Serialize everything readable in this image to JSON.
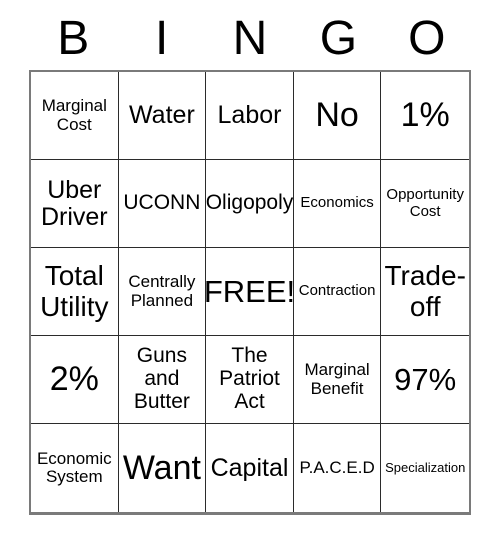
{
  "card": {
    "header_letters": [
      "B",
      "I",
      "N",
      "G",
      "O"
    ],
    "free_space_label": "FREE!",
    "colors": {
      "background": "#ffffff",
      "text": "#000000",
      "cell_border": "#2b2b2b",
      "outer_border": "#7a7a7a"
    },
    "grid": {
      "columns": 5,
      "rows": 5,
      "cells": [
        {
          "text": "Marginal\nCost",
          "size": "sm"
        },
        {
          "text": "Water",
          "size": "ml"
        },
        {
          "text": "Labor",
          "size": "ml"
        },
        {
          "text": "No",
          "size": "xxl"
        },
        {
          "text": "1%",
          "size": "xxl"
        },
        {
          "text": "Uber\nDriver",
          "size": "ml"
        },
        {
          "text": "UCONN",
          "size": "md"
        },
        {
          "text": "Oligopoly",
          "size": "md"
        },
        {
          "text": "Economics",
          "size": "xs"
        },
        {
          "text": "Opportunity\nCost",
          "size": "xs"
        },
        {
          "text": "Total\nUtility",
          "size": "lg"
        },
        {
          "text": "Centrally\nPlanned",
          "size": "sm"
        },
        {
          "text": "FREE!",
          "size": "xl"
        },
        {
          "text": "Contraction",
          "size": "xs"
        },
        {
          "text": "Trade-\noff",
          "size": "lg"
        },
        {
          "text": "2%",
          "size": "xxl"
        },
        {
          "text": "Guns\nand\nButter",
          "size": "md"
        },
        {
          "text": "The\nPatriot\nAct",
          "size": "md"
        },
        {
          "text": "Marginal\nBenefit",
          "size": "sm"
        },
        {
          "text": "97%",
          "size": "xl"
        },
        {
          "text": "Economic\nSystem",
          "size": "sm"
        },
        {
          "text": "Want",
          "size": "xxl"
        },
        {
          "text": "Capital",
          "size": "ml"
        },
        {
          "text": "P.A.C.E.D",
          "size": "sm"
        },
        {
          "text": "Specialization",
          "size": "xxs"
        }
      ]
    }
  }
}
